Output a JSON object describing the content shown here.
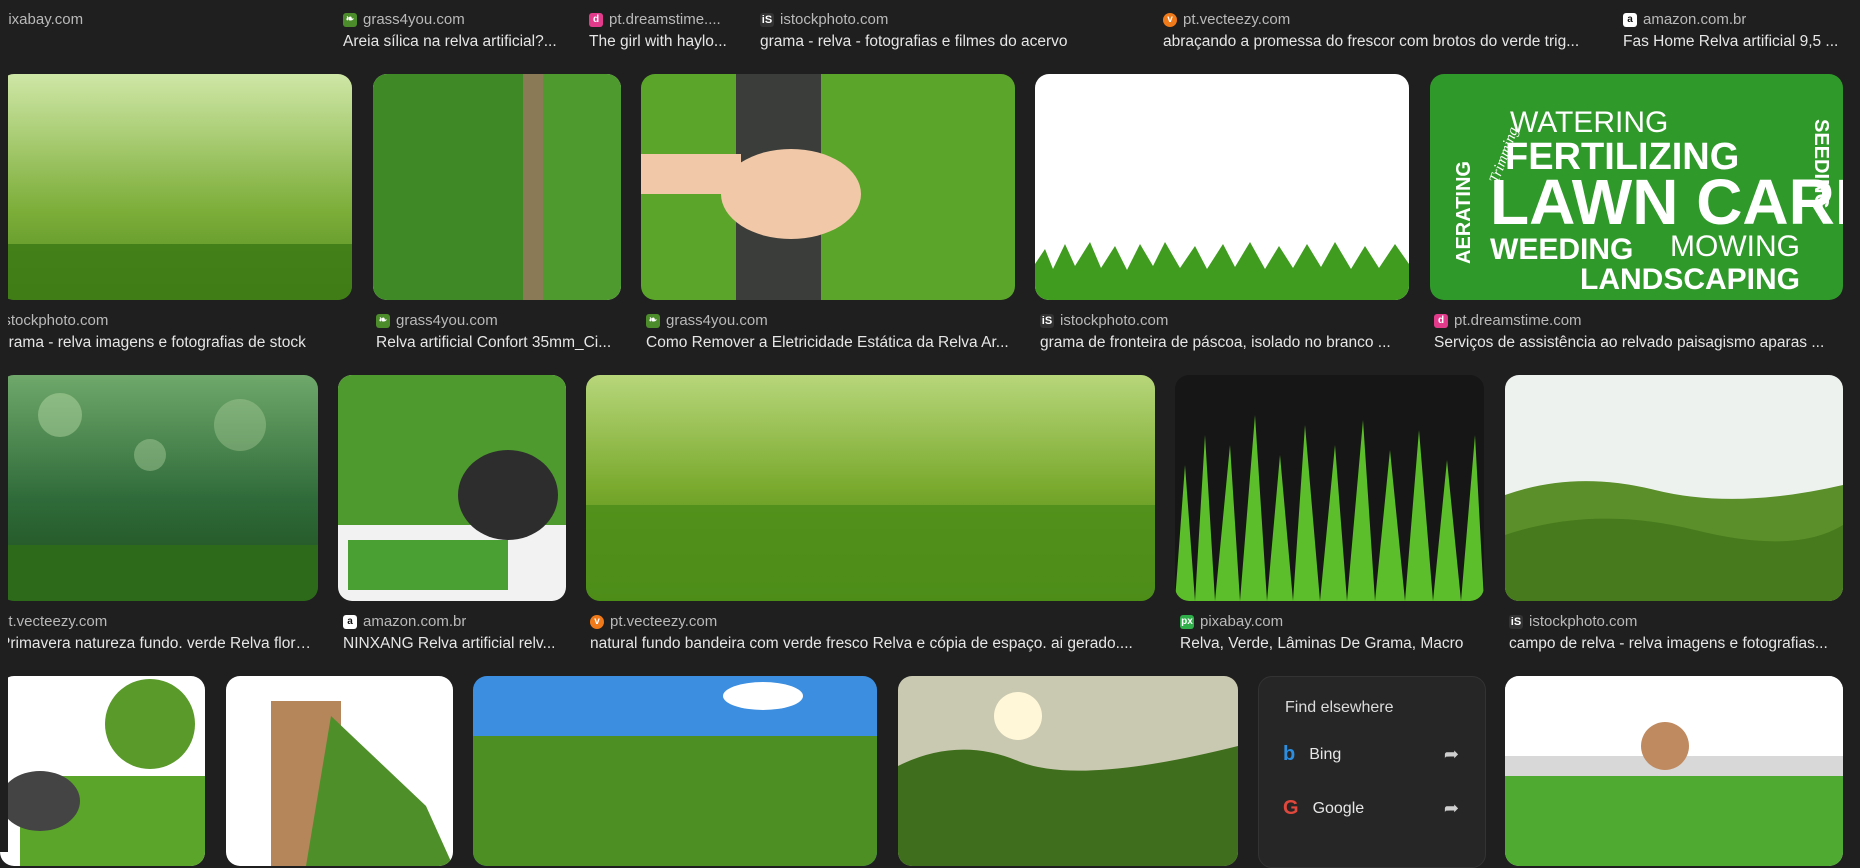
{
  "row0": [
    {
      "source": "pixabay.com",
      "title": "",
      "fav": "none"
    },
    {
      "source": "grass4you.com",
      "title": "Areia sílica na relva artificial?...",
      "fav": "grass"
    },
    {
      "source": "pt.dreamstime....",
      "title": "The girl with haylo...",
      "fav": "dreamstime"
    },
    {
      "source": "istockphoto.com",
      "title": "grama - relva - fotografias e filmes do acervo",
      "fav": "istock"
    },
    {
      "source": "pt.vecteezy.com",
      "title": "abraçando a promessa do frescor com brotos do verde trig...",
      "fav": "vecteezy"
    },
    {
      "source": "amazon.com.br",
      "title": "Fas Home Relva artificial 9,5 ...",
      "fav": "amazon"
    }
  ],
  "row1": [
    {
      "source": "istockphoto.com",
      "title": "grama - relva imagens e fotografias de stock",
      "fav": "istock"
    },
    {
      "source": "grass4you.com",
      "title": "Relva artificial Confort 35mm_Ci...",
      "fav": "grass"
    },
    {
      "source": "grass4you.com",
      "title": "Como Remover a Eletricidade Estática da Relva Ar...",
      "fav": "grass"
    },
    {
      "source": "istockphoto.com",
      "title": "grama de fronteira de páscoa, isolado no branco ...",
      "fav": "istock"
    },
    {
      "source": "pt.dreamstime.com",
      "title": "Serviços de assistência ao relvado paisagismo aparas ...",
      "fav": "dreamstime"
    }
  ],
  "row2": [
    {
      "source": "pt.vecteezy.com",
      "title": "Primavera natureza fundo. verde Relva flores...",
      "fav": "vecteezy"
    },
    {
      "source": "amazon.com.br",
      "title": "NINXANG Relva artificial relv...",
      "fav": "amazon"
    },
    {
      "source": "pt.vecteezy.com",
      "title": "natural fundo bandeira com verde fresco Relva e cópia de espaço. ai gerado....",
      "fav": "vecteezy"
    },
    {
      "source": "pixabay.com",
      "title": "Relva, Verde, Lâminas De Grama, Macro",
      "fav": "pixabay"
    },
    {
      "source": "istockphoto.com",
      "title": "campo de relva - relva imagens e fotografias...",
      "fav": "istock"
    }
  ],
  "lawncare": {
    "w1": "WATERING",
    "w2": "FERTILIZING",
    "w3": "LAWN CARE",
    "w4": "WEEDING",
    "w5": "MOWING",
    "w6": "LANDSCAPING",
    "w7": "AERATING",
    "w8": "SEEDING",
    "w9": "Trimming"
  },
  "findElsewhere": {
    "title": "Find elsewhere",
    "engines": [
      {
        "name": "Bing"
      },
      {
        "name": "Google"
      }
    ]
  },
  "colors": {
    "background": "#1f1f1f",
    "panel": "#262626",
    "text": "#e6e6e6",
    "muted": "#b9b9b9"
  }
}
